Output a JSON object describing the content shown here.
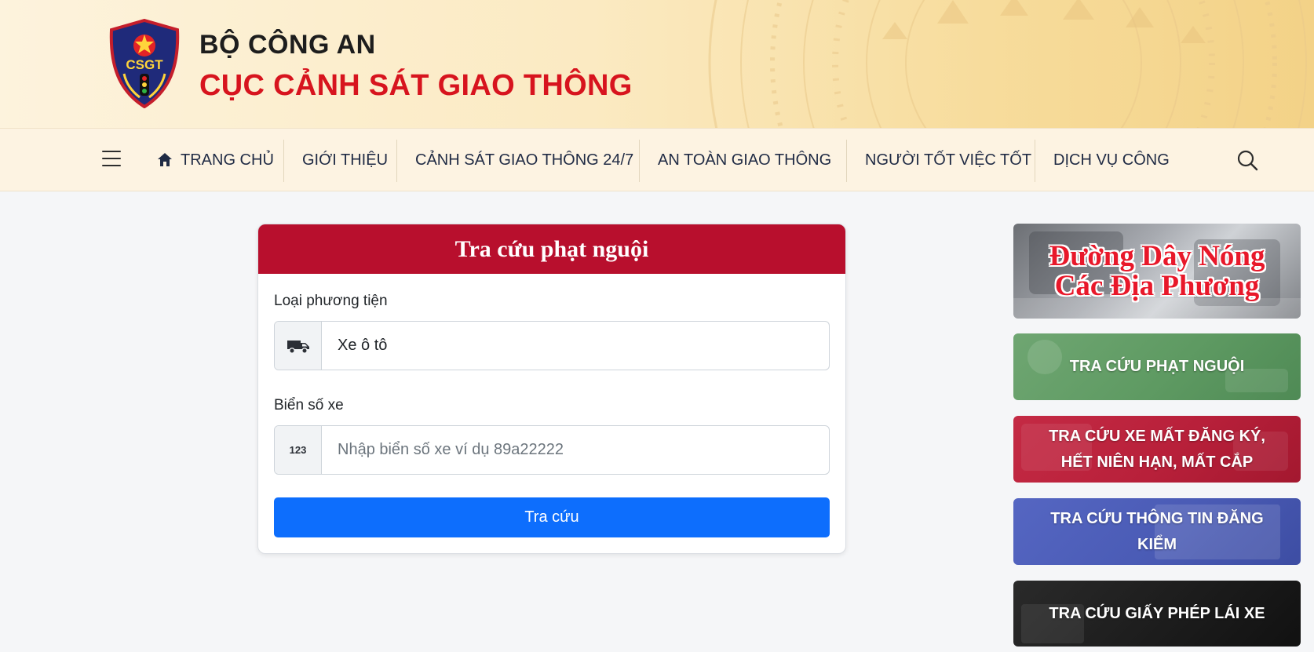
{
  "header": {
    "org": "BỘ CÔNG AN",
    "department": "CỤC CẢNH SÁT GIAO THÔNG",
    "logo_text": "CSGT"
  },
  "nav": {
    "items": [
      {
        "label": "TRANG CHỦ",
        "icon": "home-icon"
      },
      {
        "label": "GIỚI THIỆU"
      },
      {
        "label": "CẢNH SÁT GIAO THÔNG 24/7"
      },
      {
        "label": "AN TOÀN GIAO THÔNG"
      },
      {
        "label": "NGƯỜI TỐT VIỆC TỐT"
      },
      {
        "label": "DỊCH VỤ CÔNG"
      }
    ],
    "menu_icon": "hamburger-icon",
    "search_icon": "search-icon"
  },
  "form": {
    "title": "Tra cứu phạt nguội",
    "vehicle_type_label": "Loại phương tiện",
    "vehicle_type_value": "Xe ô tô",
    "vehicle_icon": "truck-icon",
    "plate_label": "Biển số xe",
    "plate_icon_text": "123",
    "plate_placeholder": "Nhập biển số xe ví dụ 89a22222",
    "submit_label": "Tra cứu"
  },
  "sidebar": {
    "hotline": {
      "line1": "Đường Dây Nóng",
      "line2": "Các Địa Phương"
    },
    "links": [
      {
        "label": "TRA CỨU PHẠT NGUỘI",
        "color": "#5e9a62"
      },
      {
        "label": "TRA CỨU XE MẤT ĐĂNG KÝ, HẾT NIÊN HẠN, MẤT CẮP",
        "color": "#b8203a"
      },
      {
        "label": "TRA CỨU THÔNG TIN ĐĂNG KIỂM",
        "color": "#4a5bb5"
      },
      {
        "label": "TRA CỨU GIẤY PHÉP LÁI XE",
        "color": "#1b1b1b"
      }
    ]
  },
  "colors": {
    "brand_red": "#d7141e",
    "card_header": "#b80f2d",
    "primary_button": "#0d6efd"
  }
}
